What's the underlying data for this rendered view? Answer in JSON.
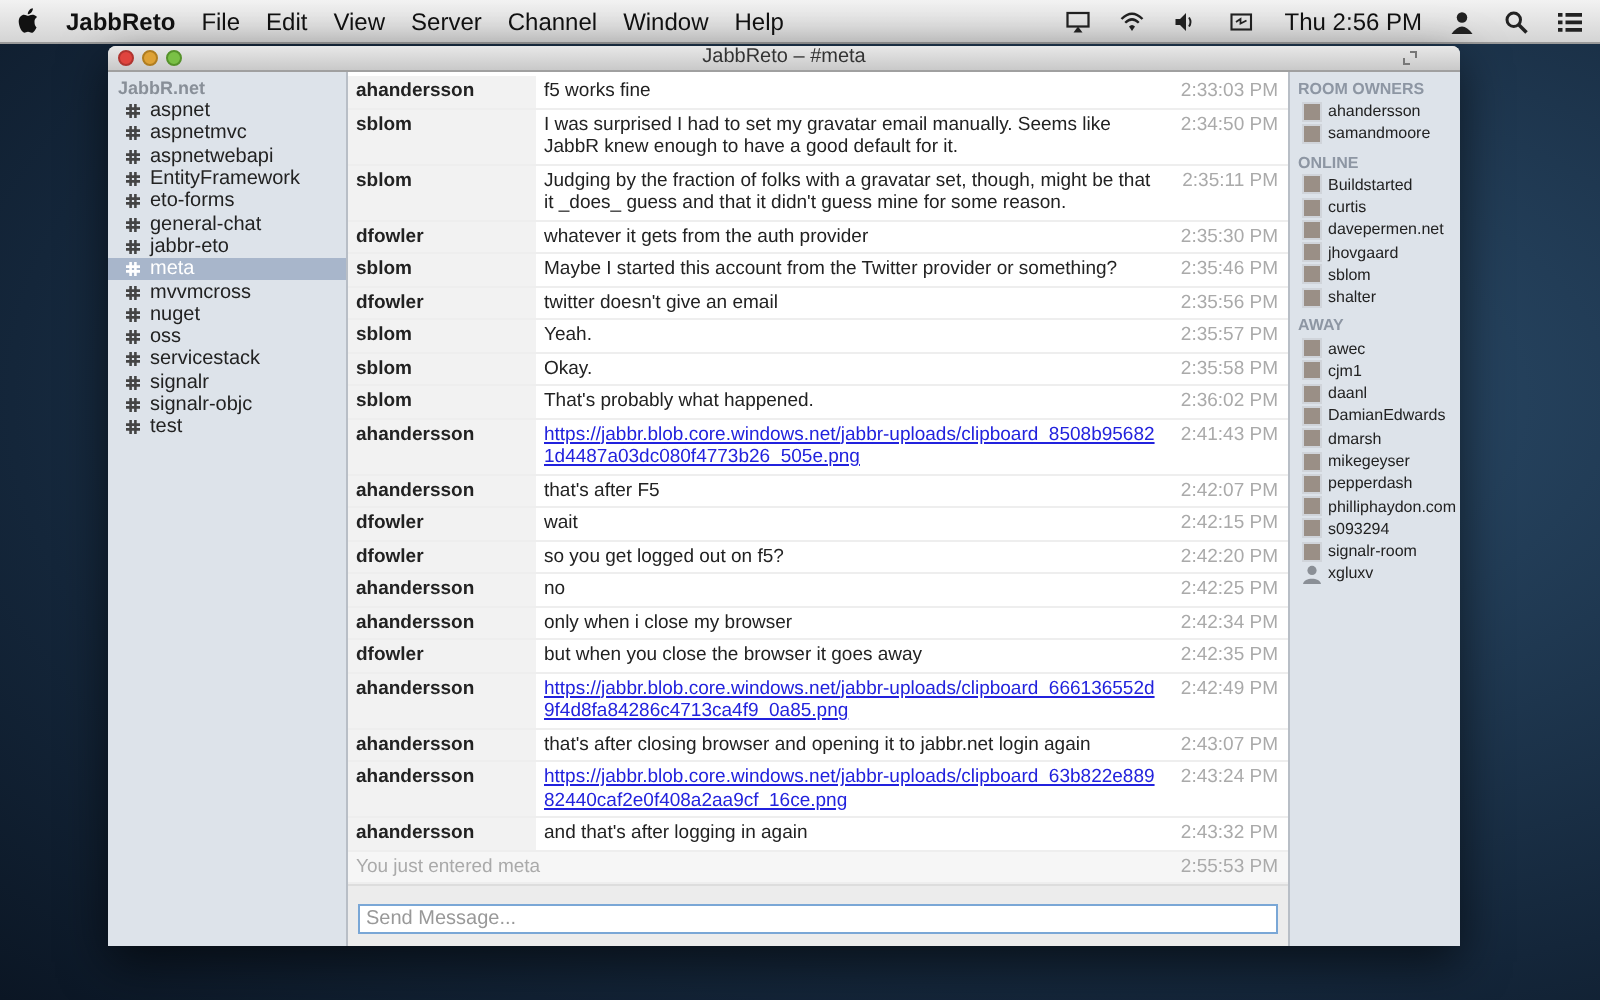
{
  "menu_bar": {
    "app_name": "JabbReto",
    "menus": [
      "File",
      "Edit",
      "View",
      "Server",
      "Channel",
      "Window",
      "Help"
    ],
    "clock": "Thu 2:56 PM"
  },
  "window": {
    "title": "JabbReto – #meta"
  },
  "sidebar": {
    "heading": "JabbR.net",
    "items": [
      {
        "label": "aspnet",
        "selected": false
      },
      {
        "label": "aspnetmvc",
        "selected": false
      },
      {
        "label": "aspnetwebapi",
        "selected": false
      },
      {
        "label": "EntityFramework",
        "selected": false
      },
      {
        "label": "eto-forms",
        "selected": false
      },
      {
        "label": "general-chat",
        "selected": false
      },
      {
        "label": "jabbr-eto",
        "selected": false
      },
      {
        "label": "meta",
        "selected": true
      },
      {
        "label": "mvvmcross",
        "selected": false
      },
      {
        "label": "nuget",
        "selected": false
      },
      {
        "label": "oss",
        "selected": false
      },
      {
        "label": "servicestack",
        "selected": false
      },
      {
        "label": "signalr",
        "selected": false
      },
      {
        "label": "signalr-objc",
        "selected": false
      },
      {
        "label": "test",
        "selected": false
      }
    ]
  },
  "messages": [
    {
      "kind": "text",
      "author": "ahandersson",
      "text": "f5 works fine",
      "time": "2:33:03 PM"
    },
    {
      "kind": "text",
      "author": "sblom",
      "text": "I was surprised I had to set my gravatar email manually. Seems like JabbR knew enough to have a good default for it.",
      "time": "2:34:50 PM"
    },
    {
      "kind": "text",
      "author": "sblom",
      "text": "Judging by the fraction of folks with a gravatar set, though, might be that it _does_ guess and that it didn't guess mine for some reason.",
      "time": "2:35:11 PM"
    },
    {
      "kind": "text",
      "author": "dfowler",
      "text": "whatever it gets from the auth provider",
      "time": "2:35:30 PM"
    },
    {
      "kind": "text",
      "author": "sblom",
      "text": "Maybe I started this account from the Twitter provider or something?",
      "time": "2:35:46 PM"
    },
    {
      "kind": "text",
      "author": "dfowler",
      "text": "twitter doesn't give an email",
      "time": "2:35:56 PM"
    },
    {
      "kind": "text",
      "author": "sblom",
      "text": "Yeah.",
      "time": "2:35:57 PM"
    },
    {
      "kind": "text",
      "author": "sblom",
      "text": "Okay.",
      "time": "2:35:58 PM"
    },
    {
      "kind": "text",
      "author": "sblom",
      "text": "That's probably what happened.",
      "time": "2:36:02 PM"
    },
    {
      "kind": "link",
      "author": "ahandersson",
      "text": "https://jabbr.blob.core.windows.net/jabbr-uploads/clipboard_8508b956821d4487a03dc080f4773b26_505e.png",
      "time": "2:41:43 PM"
    },
    {
      "kind": "text",
      "author": "ahandersson",
      "text": "that's after F5",
      "time": "2:42:07 PM"
    },
    {
      "kind": "text",
      "author": "dfowler",
      "text": "wait",
      "time": "2:42:15 PM"
    },
    {
      "kind": "text",
      "author": "dfowler",
      "text": "so you get logged out on f5?",
      "time": "2:42:20 PM"
    },
    {
      "kind": "text",
      "author": "ahandersson",
      "text": "no",
      "time": "2:42:25 PM"
    },
    {
      "kind": "text",
      "author": "ahandersson",
      "text": "only when i close my browser",
      "time": "2:42:34 PM"
    },
    {
      "kind": "text",
      "author": "dfowler",
      "text": "but when you close the browser it goes away",
      "time": "2:42:35 PM"
    },
    {
      "kind": "link",
      "author": "ahandersson",
      "text": "https://jabbr.blob.core.windows.net/jabbr-uploads/clipboard_666136552d9f4d8fa84286c4713ca4f9_0a85.png",
      "time": "2:42:49 PM"
    },
    {
      "kind": "text",
      "author": "ahandersson",
      "text": "that's after closing browser and opening it to jabbr.net login again",
      "time": "2:43:07 PM"
    },
    {
      "kind": "link",
      "author": "ahandersson",
      "text": "https://jabbr.blob.core.windows.net/jabbr-uploads/clipboard_63b822e88982440caf2e0f408a2aa9cf_16ce.png",
      "time": "2:43:24 PM"
    },
    {
      "kind": "text",
      "author": "ahandersson",
      "text": "and that's after logging in again",
      "time": "2:43:32 PM"
    },
    {
      "kind": "notice",
      "text": "You just entered meta",
      "time": "2:55:53 PM"
    }
  ],
  "composer": {
    "placeholder": "Send Message..."
  },
  "users": [
    {
      "heading": "ROOM OWNERS",
      "members": [
        {
          "name": "ahandersson",
          "kind": "photo"
        },
        {
          "name": "samandmoore",
          "kind": "photo"
        }
      ]
    },
    {
      "heading": "ONLINE",
      "members": [
        {
          "name": "Buildstarted",
          "kind": "photo"
        },
        {
          "name": "curtis",
          "kind": "photo"
        },
        {
          "name": "davepermen.net",
          "kind": "photo"
        },
        {
          "name": "jhovgaard",
          "kind": "photo"
        },
        {
          "name": "sblom",
          "kind": "photo"
        },
        {
          "name": "shalter",
          "kind": "photo"
        }
      ]
    },
    {
      "heading": "AWAY",
      "members": [
        {
          "name": "awec",
          "kind": "photo"
        },
        {
          "name": "cjm1",
          "kind": "photo"
        },
        {
          "name": "daanl",
          "kind": "photo"
        },
        {
          "name": "DamianEdwards",
          "kind": "photo"
        },
        {
          "name": "dmarsh",
          "kind": "photo"
        },
        {
          "name": "mikegeyser",
          "kind": "photo"
        },
        {
          "name": "pepperdash",
          "kind": "photo"
        },
        {
          "name": "philliphaydon.com",
          "kind": "photo"
        },
        {
          "name": "s093294",
          "kind": "photo"
        },
        {
          "name": "signalr-room",
          "kind": "photo"
        },
        {
          "name": "xgluxv",
          "kind": "default"
        }
      ]
    }
  ]
}
